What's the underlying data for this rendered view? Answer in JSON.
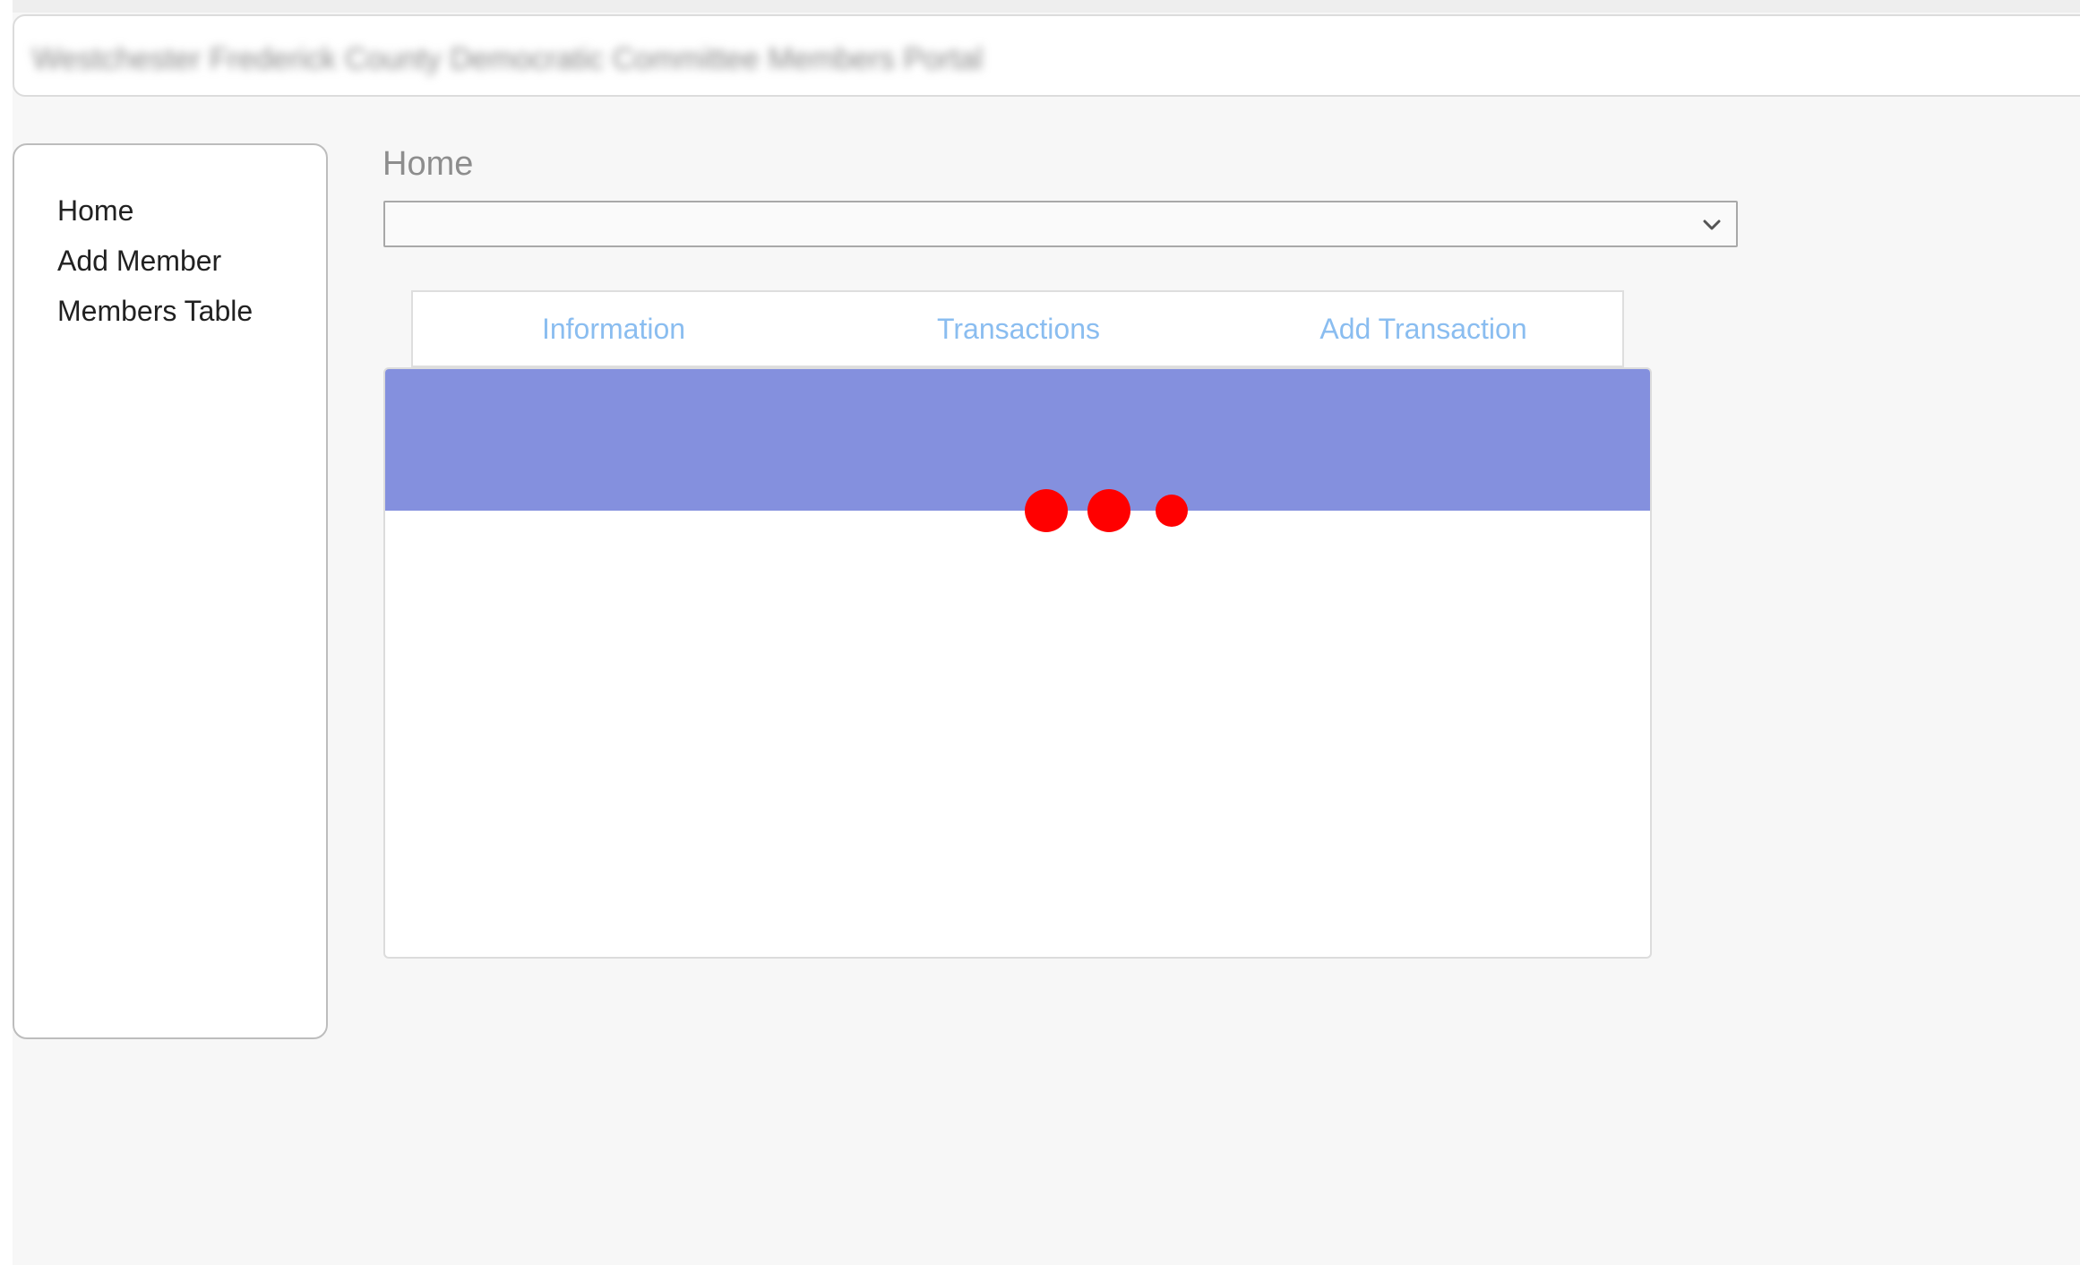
{
  "header": {
    "title": "Westchester Frederick County Democratic Committee Members Portal"
  },
  "sidebar": {
    "items": [
      {
        "label": "Home"
      },
      {
        "label": "Add Member"
      },
      {
        "label": "Members Table"
      }
    ]
  },
  "main": {
    "title": "Home",
    "member_select": {
      "selected": ""
    },
    "tabs": [
      {
        "label": "Information"
      },
      {
        "label": "Transactions"
      },
      {
        "label": "Add Transaction"
      }
    ]
  },
  "colors": {
    "page_background": "#f7f7f7",
    "tab_text": "#8abdf0",
    "card_band": "#8490de",
    "loading_dots": "#ff0000"
  },
  "icons": {
    "select_indicator": "chevron-down-icon",
    "loading": "loading-dots-icon"
  }
}
